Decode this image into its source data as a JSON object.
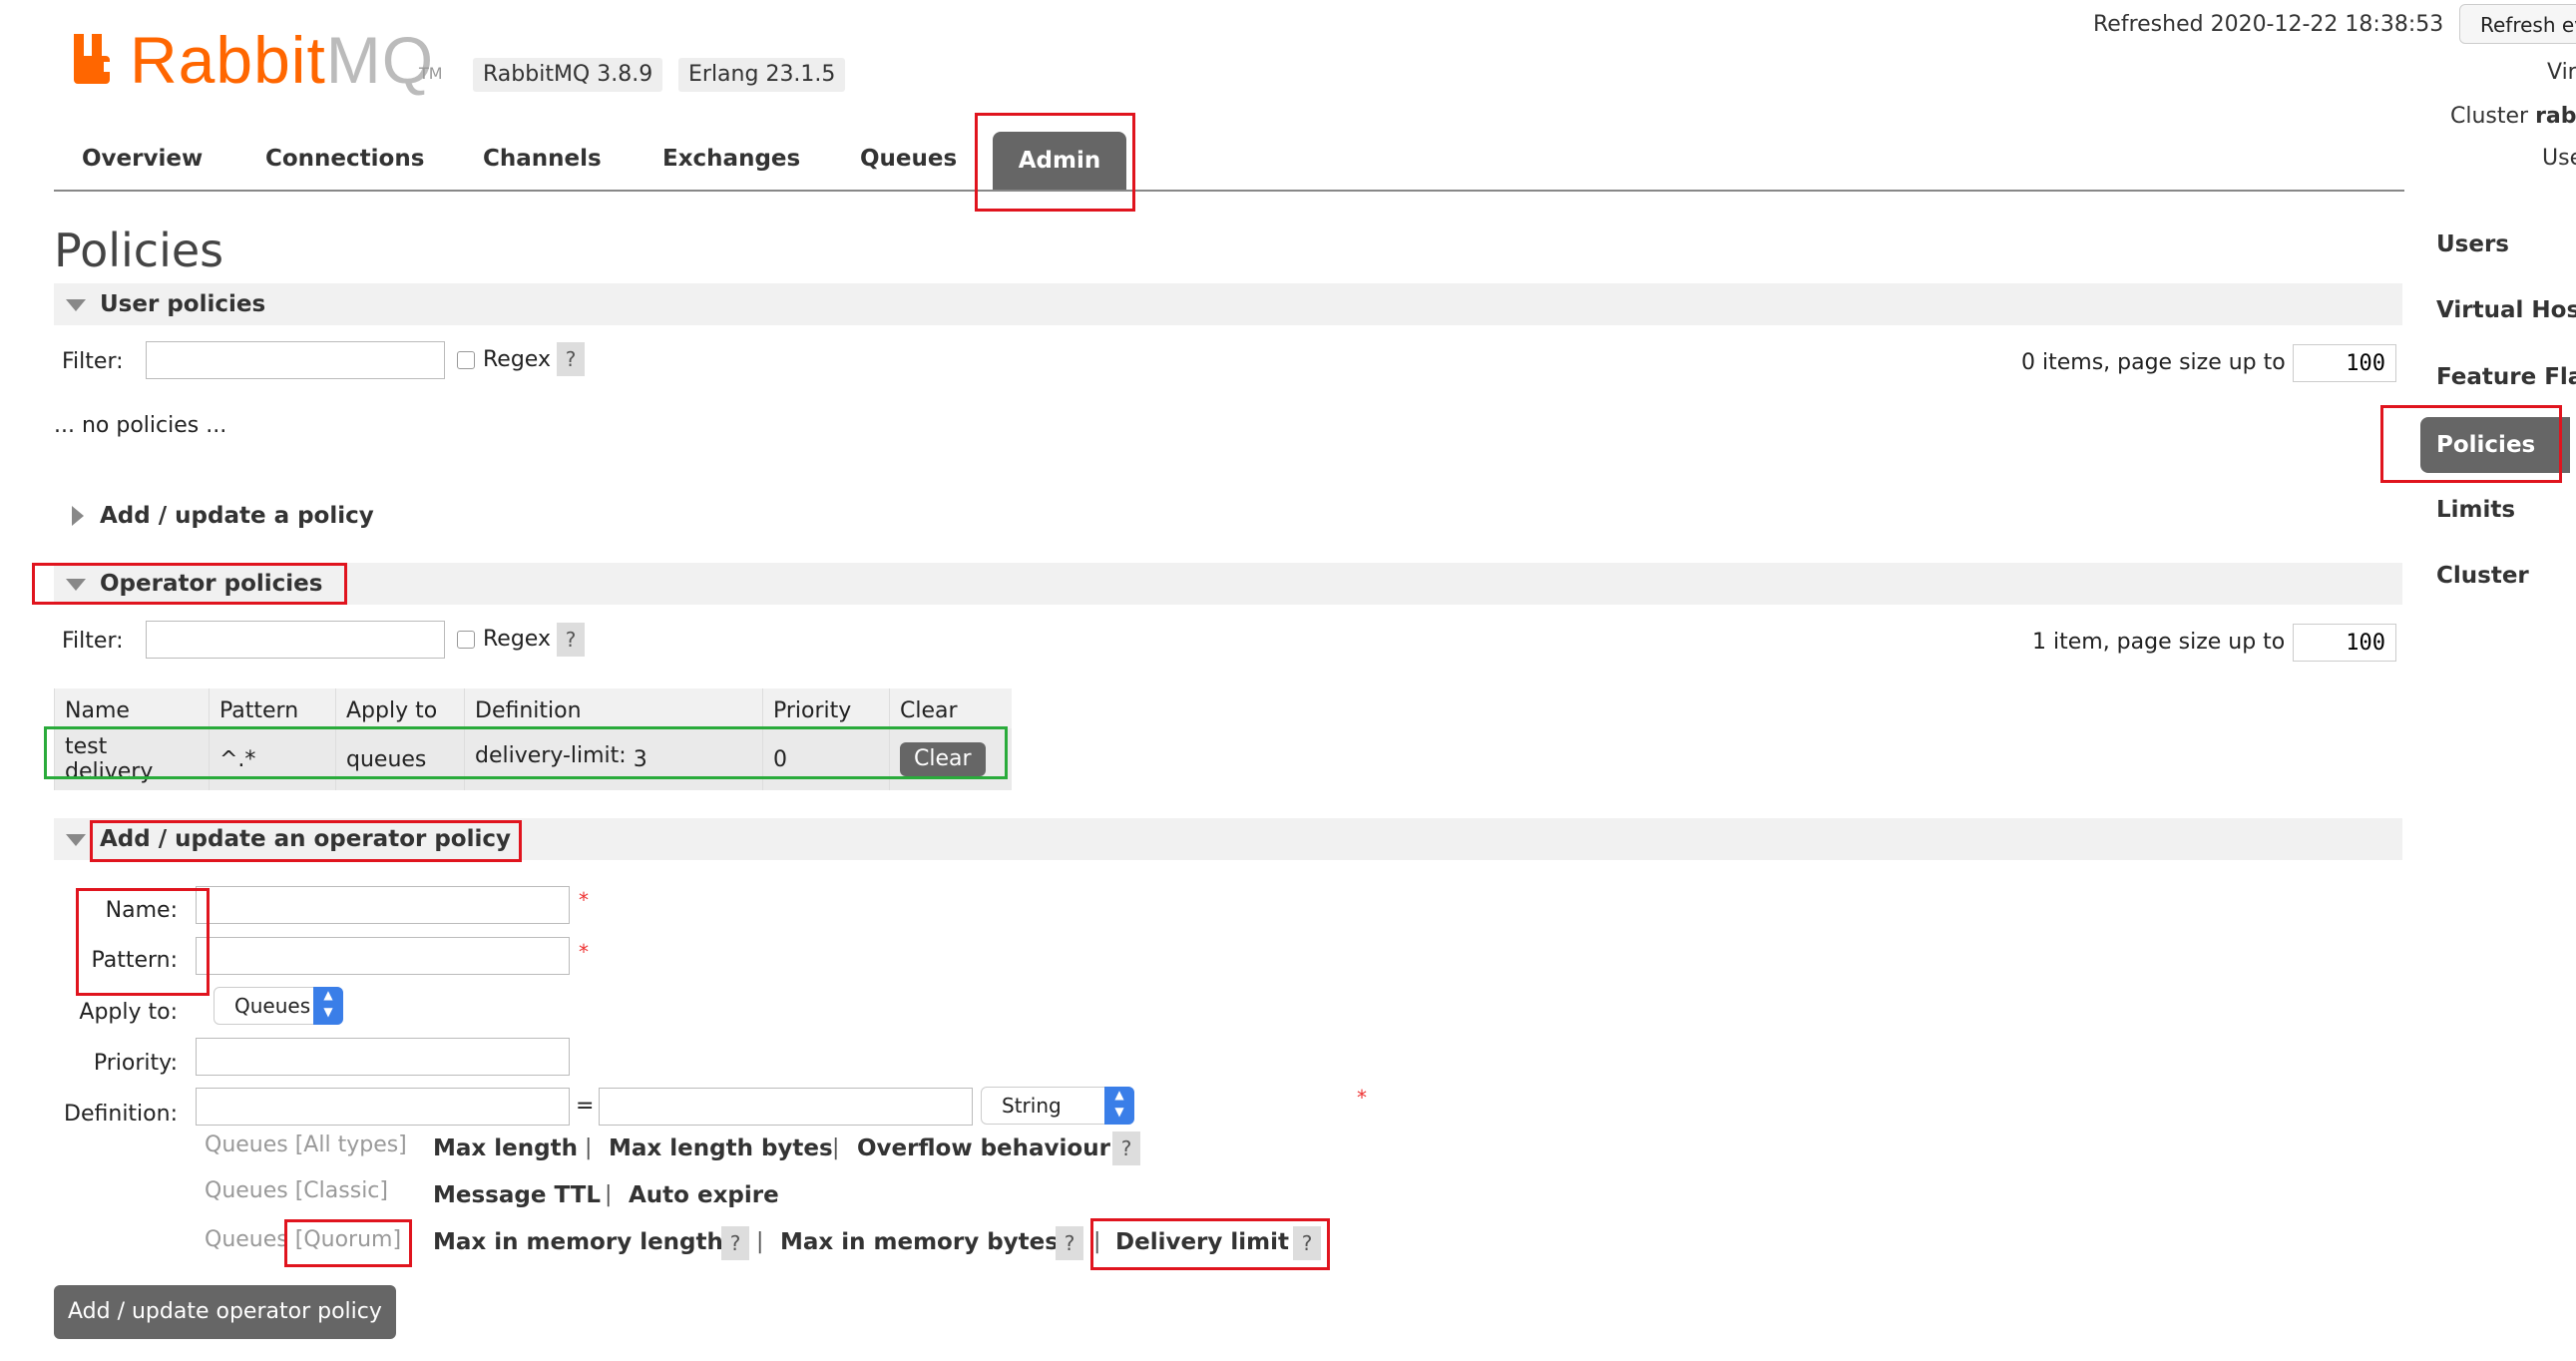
{
  "header": {
    "logo_text_main": "Rabbit",
    "logo_text_mq": "MQ",
    "logo_tm": "TM",
    "rabbitmq_version": "RabbitMQ 3.8.9",
    "erlang_version": "Erlang 23.1.5",
    "refreshed": "Refreshed 2020-12-22 18:38:53",
    "refresh_button": "Refresh ev",
    "virtual_host_label": "Vir",
    "cluster_label": "Cluster ",
    "cluster_value": "rab",
    "user_label": "Use"
  },
  "nav": {
    "tabs": [
      "Overview",
      "Connections",
      "Channels",
      "Exchanges",
      "Queues"
    ],
    "active_tab": "Admin"
  },
  "page_title": "Policies",
  "user_policies": {
    "section_label": "User policies",
    "filter_label": "Filter:",
    "filter_value": "",
    "regex_label": "Regex",
    "help": "?",
    "count_text": "0 items, page size up to",
    "page_size": "100",
    "empty_text": "... no policies ..."
  },
  "add_policy_section": "Add / update a policy",
  "operator_policies": {
    "section_label": "Operator policies",
    "filter_label": "Filter:",
    "filter_value": "",
    "regex_label": "Regex",
    "help": "?",
    "count_text": "1 item, page size up to",
    "page_size": "100",
    "columns": [
      "Name",
      "Pattern",
      "Apply to",
      "Definition",
      "Priority",
      "Clear"
    ],
    "rows": [
      {
        "name": "test delivery",
        "pattern": "^.*",
        "apply_to": "queues",
        "def_key": "delivery-limit:",
        "def_value": "3",
        "priority": "0",
        "clear": "Clear"
      }
    ]
  },
  "operator_form": {
    "section_label": "Add / update an operator policy",
    "name_label": "Name:",
    "pattern_label": "Pattern:",
    "apply_to_label": "Apply to:",
    "apply_to_value": "Queues",
    "priority_label": "Priority:",
    "definition_label": "Definition:",
    "equals": "=",
    "type_value": "String",
    "required": "*",
    "help": "?",
    "separator": "|",
    "groups": [
      {
        "type": "Queues [All types]",
        "links": [
          "Max length",
          "Max length bytes",
          "Overflow behaviour"
        ]
      },
      {
        "type": "Queues [Classic]",
        "links": [
          "Message TTL",
          "Auto expire"
        ]
      },
      {
        "type_prefix": "Queues",
        "type_suffix": "[Quorum]",
        "links": [
          "Max in memory length",
          "Max in memory bytes",
          "Delivery limit"
        ]
      }
    ],
    "submit": "Add / update operator policy"
  },
  "sidebar": {
    "items": [
      "Users",
      "Virtual Host",
      "Feature Flag",
      "Policies",
      "Limits",
      "Cluster"
    ],
    "active": "Policies"
  },
  "colors": {
    "brand": "#ff6600",
    "highlight_red": "#e0141e",
    "highlight_green": "#2aab3b",
    "button_gray": "#666666"
  }
}
